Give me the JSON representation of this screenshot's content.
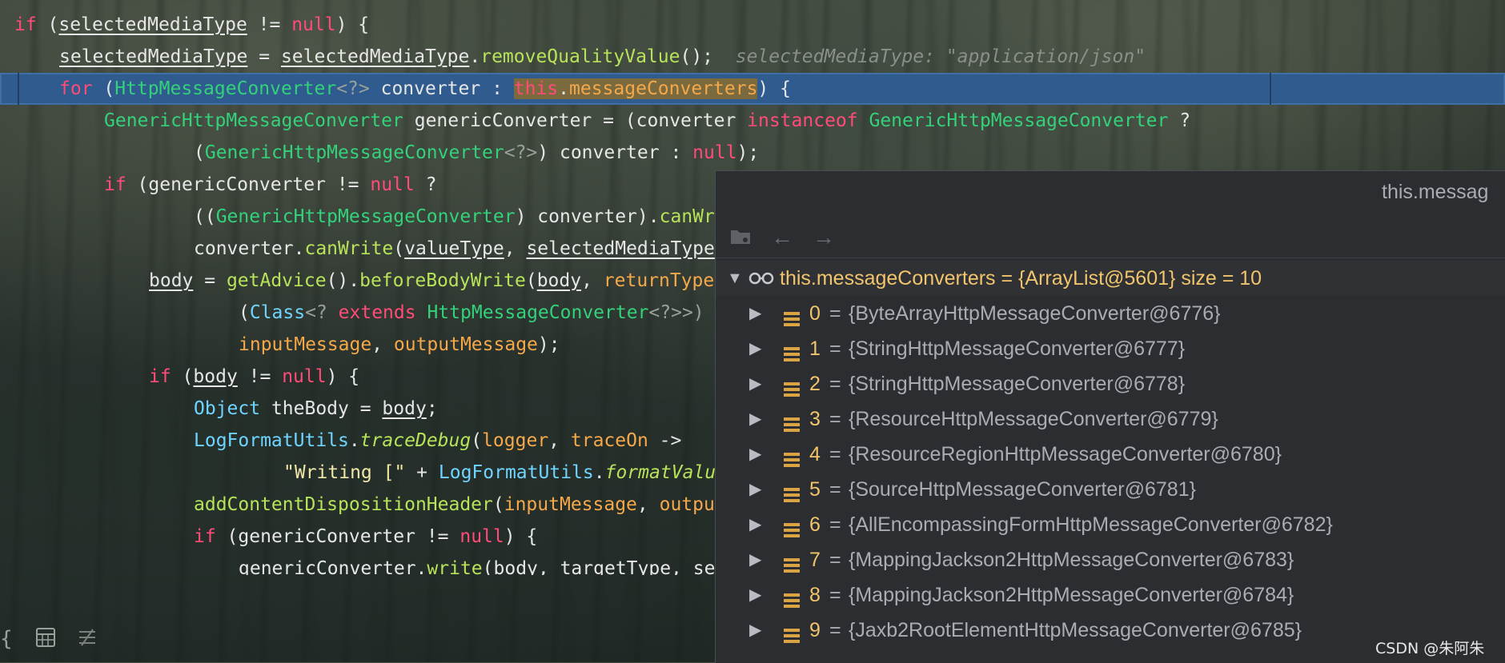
{
  "code": {
    "line1": {
      "kw_if": "if",
      "p1": " (",
      "var": "selectedMediaType",
      "op": " != ",
      "null": "null",
      "p2": ") {"
    },
    "line2": {
      "var": "selectedMediaType",
      "eq": " = ",
      "var2": "selectedMediaType",
      "dot": ".",
      "method": "removeQualityValue",
      "tail": "();",
      "hint": "selectedMediaType: \"application/json\""
    },
    "line3": {
      "kw_for": "for",
      "p1": " (",
      "type": "HttpMessageConverter",
      "gen": "<?>",
      "name": " converter : ",
      "this": "this",
      "dot": ".",
      "field": "messageConverters",
      "tail": ") {"
    },
    "line4": {
      "type": "GenericHttpMessageConverter",
      "name": " genericConverter = (converter ",
      "kw": "instanceof",
      "sp": " ",
      "type2": "GenericHttpMessageConverter",
      "tail": " ?"
    },
    "line5": {
      "p1": "(",
      "type": "GenericHttpMessageConverter",
      "gen": "<?>",
      "mid": ") converter : ",
      "null": "null",
      "tail": ");"
    },
    "line6": {
      "kw_if": "if",
      "p1": " (genericConverter != ",
      "null": "null",
      "tail": " ?"
    },
    "line7": {
      "p1": "((",
      "type": "GenericHttpMessageConverter",
      "mid": ") converter).",
      "method": "canWr"
    },
    "line8": {
      "p1": "converter.",
      "method": "canWrite",
      "p2": "(",
      "var1": "valueType",
      "comma": ", ",
      "var2": "selectedMediaType"
    },
    "line9": {
      "var": "body",
      "eq": " = ",
      "method": "getAdvice",
      "p": "().",
      "method2": "beforeBodyWrite",
      "p2": "(",
      "var2": "body",
      "comma": ", ",
      "param": "returnType"
    },
    "line10": {
      "p1": "(",
      "type": "Class",
      "gen1": "<? ",
      "kw": "extends",
      "sp": " ",
      "type2": "HttpMessageConverter",
      "gen2": "<?>>) "
    },
    "line11": {
      "param1": "inputMessage",
      "comma": ", ",
      "param2": "outputMessage",
      "tail": ");"
    },
    "line12": {
      "kw_if": "if",
      "p1": " (",
      "var": "body",
      "op": " != ",
      "null": "null",
      "tail": ") {"
    },
    "line13": {
      "type": "Object",
      "name": " theBody = ",
      "var": "body",
      "tail": ";"
    },
    "line14": {
      "type": "LogFormatUtils",
      "dot": ".",
      "method": "traceDebug",
      "p": "(",
      "param1": "logger",
      "comma": ", ",
      "param2": "traceOn",
      "arrow": " ->"
    },
    "line15": {
      "str": "\"Writing [\"",
      "plus": " + ",
      "type": "LogFormatUtils",
      "dot": ".",
      "method": "formatValu"
    },
    "line16": {
      "method": "addContentDispositionHeader",
      "p": "(",
      "param1": "inputMessage",
      "comma": ", ",
      "param2": "outpu"
    },
    "line17": {
      "kw_if": "if",
      "p1": " (genericConverter != ",
      "null": "null",
      "tail": ") {"
    },
    "line18": {
      "p1": "genericConverter.",
      "method": "write",
      "p2": "(body, targetType, se"
    }
  },
  "popup": {
    "title": "this.messag",
    "toolbar": {
      "icon1": "folder-tree-icon",
      "icon2": "back-arrow-icon",
      "icon3": "forward-arrow-icon"
    },
    "root": {
      "label": "this.messageConverters = {ArrayList@5601}  size = 10"
    },
    "items": [
      {
        "index": "0",
        "value": "{ByteArrayHttpMessageConverter@6776}"
      },
      {
        "index": "1",
        "value": "{StringHttpMessageConverter@6777}"
      },
      {
        "index": "2",
        "value": "{StringHttpMessageConverter@6778}"
      },
      {
        "index": "3",
        "value": "{ResourceHttpMessageConverter@6779}"
      },
      {
        "index": "4",
        "value": "{ResourceRegionHttpMessageConverter@6780}"
      },
      {
        "index": "5",
        "value": "{SourceHttpMessageConverter@6781}"
      },
      {
        "index": "6",
        "value": "{AllEncompassingFormHttpMessageConverter@6782}"
      },
      {
        "index": "7",
        "value": "{MappingJackson2HttpMessageConverter@6783}"
      },
      {
        "index": "8",
        "value": "{MappingJackson2HttpMessageConverter@6784}"
      },
      {
        "index": "9",
        "value": "{Jaxb2RootElementHttpMessageConverter@6785}"
      }
    ],
    "eq": "="
  },
  "watermark": "CSDN @朱阿朱",
  "colors": {
    "keyword": "#ff4b78",
    "type": "#33d17a",
    "method": "#b6e35a",
    "field": "#f5a84a",
    "highlight": "#2f5b8e",
    "popup_bg": "#2b2d30",
    "index": "#f2c46b"
  }
}
